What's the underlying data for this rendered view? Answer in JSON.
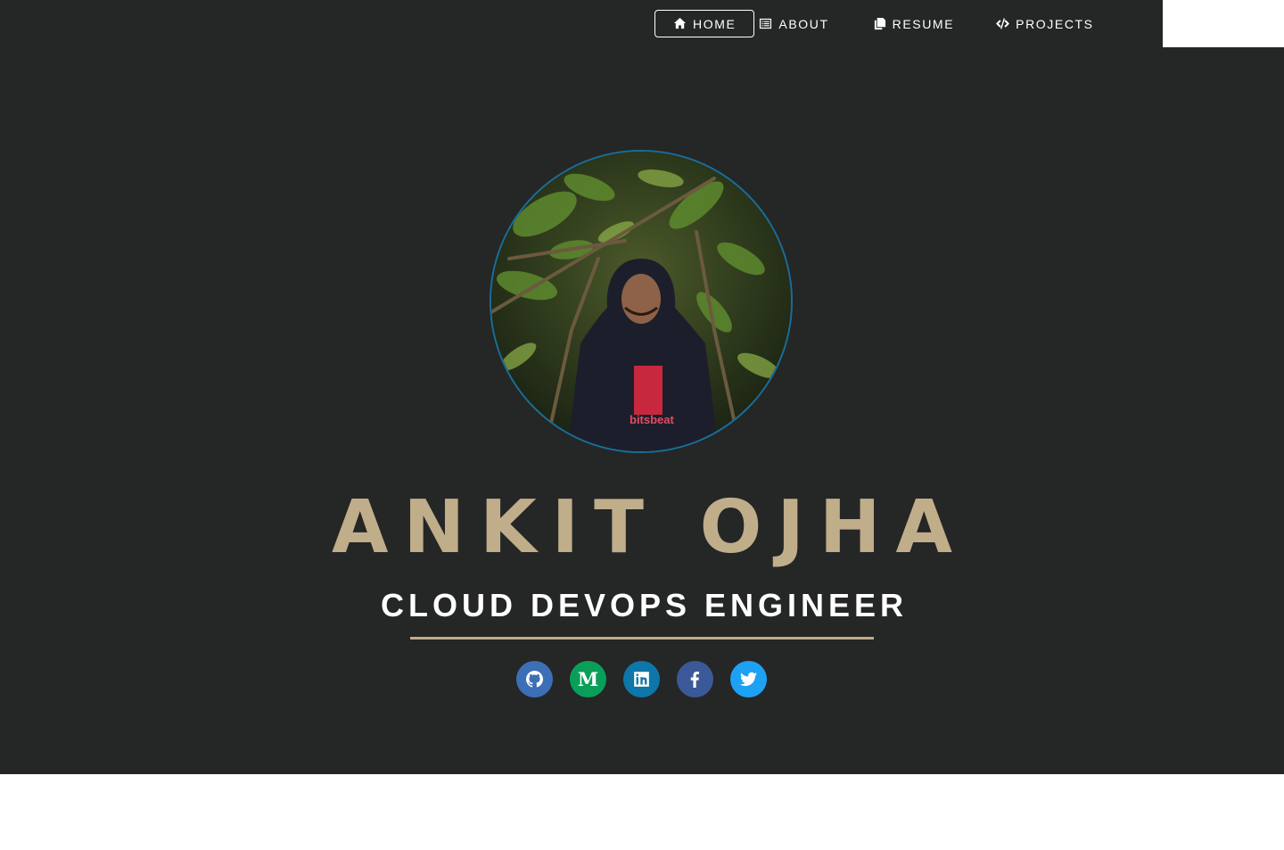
{
  "nav": {
    "items": [
      {
        "label": "HOME",
        "icon": "home-icon",
        "active": true
      },
      {
        "label": "ABOUT",
        "icon": "list-alt-icon",
        "active": false
      },
      {
        "label": "RESUME",
        "icon": "copy-icon",
        "active": false
      },
      {
        "label": "PROJECTS",
        "icon": "code-icon",
        "active": false
      }
    ]
  },
  "hero": {
    "name": "ANKIT OJHA",
    "title": "CLOUD DEVOPS ENGINEER",
    "photo_shirt_text": "bitsbeat"
  },
  "socials": [
    {
      "name": "github",
      "icon": "github-icon",
      "color": "#3d6fb6"
    },
    {
      "name": "medium",
      "icon": "medium-icon",
      "color": "#0a9f59",
      "glyph": "M"
    },
    {
      "name": "linkedin",
      "icon": "linkedin-icon",
      "color": "#0e76a8"
    },
    {
      "name": "facebook",
      "icon": "facebook-icon",
      "color": "#3b5998"
    },
    {
      "name": "twitter",
      "icon": "twitter-icon",
      "color": "#1da1f2"
    }
  ],
  "colors": {
    "background": "#252626",
    "accent": "#c0ad8a",
    "avatar_border": "#1a6d9a"
  }
}
